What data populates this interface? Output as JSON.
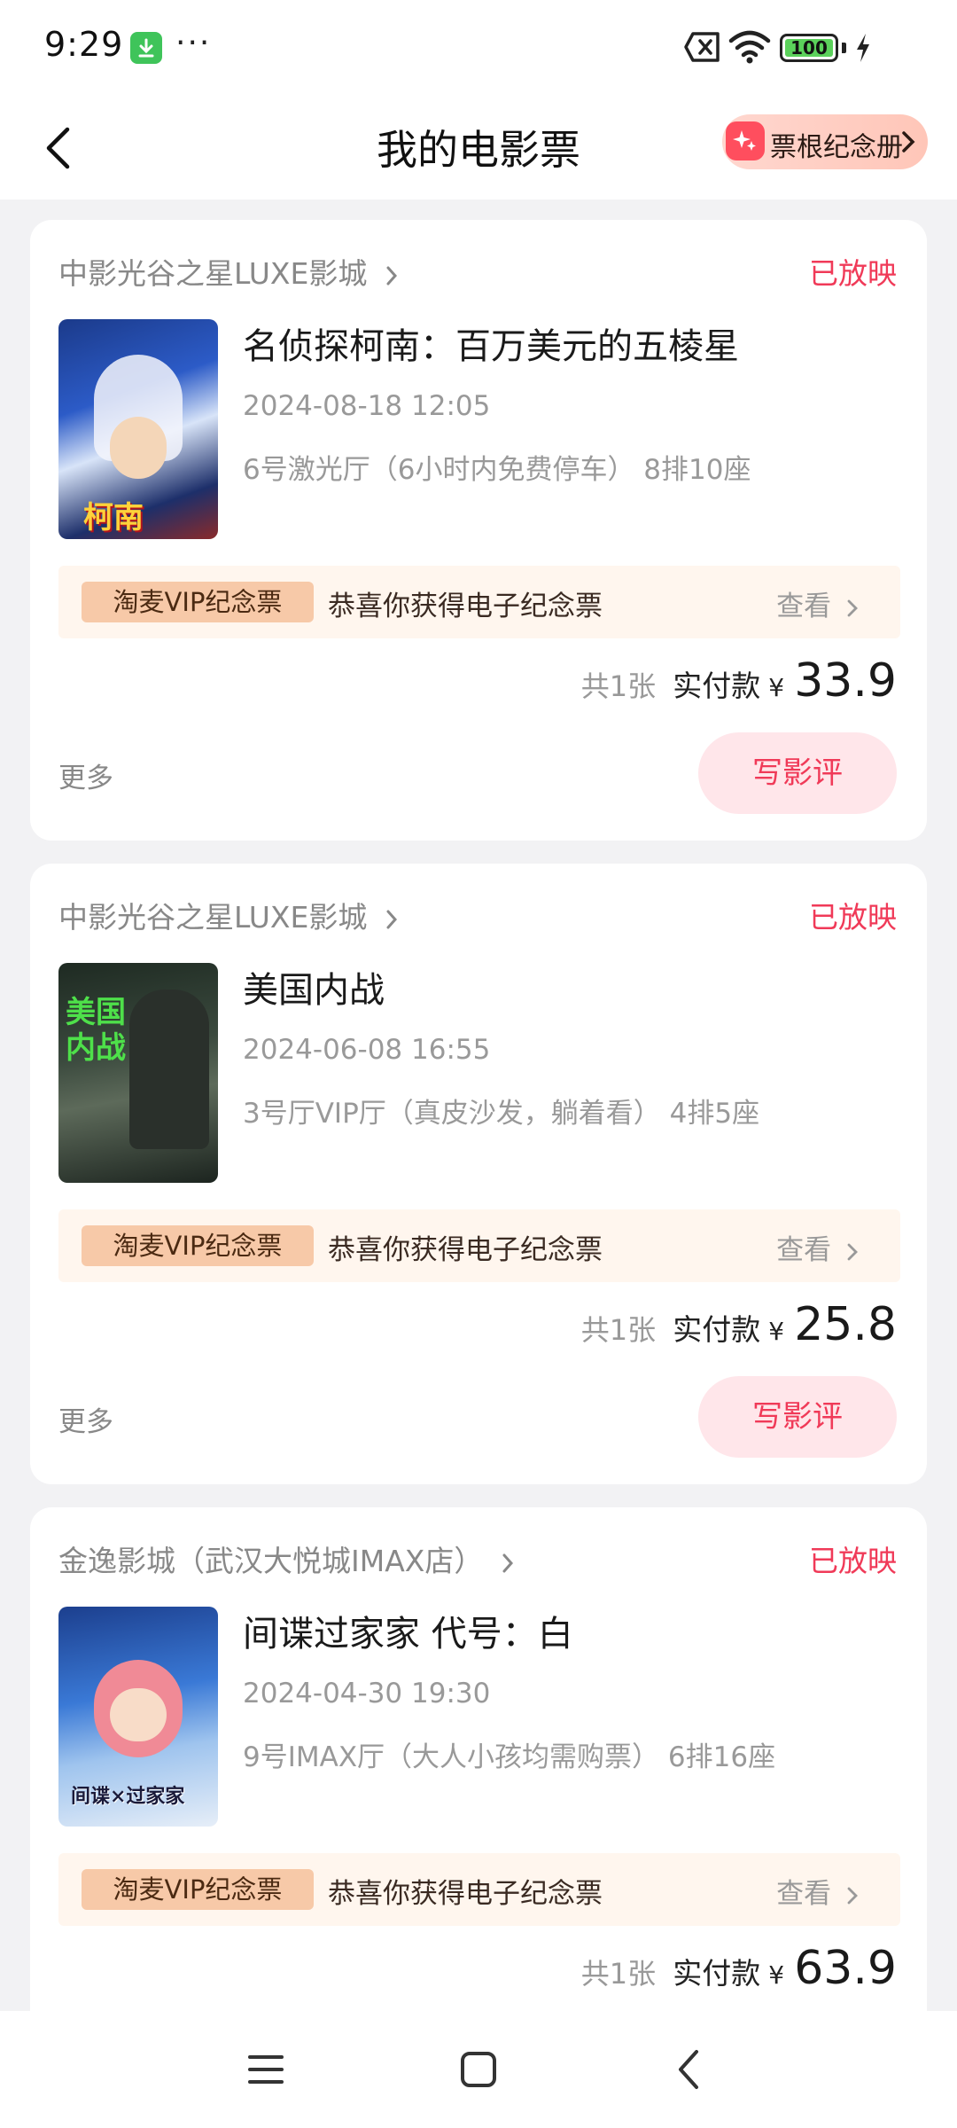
{
  "status_bar": {
    "time": "9:29",
    "dots": "···",
    "battery": "100"
  },
  "header": {
    "title": "我的电影票",
    "stub_button": "票根纪念册"
  },
  "tickets": [
    {
      "cinema": "中影光谷之星LUXE影城",
      "status": "已放映",
      "title": "名侦探柯南：百万美元的五棱星",
      "time": "2024-08-18 12:05",
      "hall": "6号激光厅（6小时内免费停车） 8排10座",
      "vip_tag": "淘麦VIP纪念票",
      "vip_msg": "恭喜你获得电子纪念票",
      "vip_view": "查看",
      "count": "共1张",
      "paid_label": "实付款",
      "currency": "¥",
      "price": "33.9",
      "more": "更多",
      "review": "写影评"
    },
    {
      "cinema": "中影光谷之星LUXE影城",
      "status": "已放映",
      "title": "美国内战",
      "time": "2024-06-08 16:55",
      "hall": "3号厅VIP厅（真皮沙发，躺着看） 4排5座",
      "vip_tag": "淘麦VIP纪念票",
      "vip_msg": "恭喜你获得电子纪念票",
      "vip_view": "查看",
      "count": "共1张",
      "paid_label": "实付款",
      "currency": "¥",
      "price": "25.8",
      "more": "更多",
      "review": "写影评"
    },
    {
      "cinema": "金逸影城（武汉大悦城IMAX店）",
      "status": "已放映",
      "title": "间谍过家家 代号：白",
      "time": "2024-04-30 19:30",
      "hall": "9号IMAX厅（大人小孩均需购票） 6排16座",
      "vip_tag": "淘麦VIP纪念票",
      "vip_msg": "恭喜你获得电子纪念票",
      "vip_view": "查看",
      "count": "共1张",
      "paid_label": "实付款",
      "currency": "¥",
      "price": "63.9"
    }
  ],
  "posters": {
    "p1_title": "柯南",
    "p2_title": "美国内战",
    "p3_title": "间谍×过家家"
  },
  "colors": {
    "accent": "#f03a58",
    "review_bg": "#ffe6ea",
    "vip_bg": "#fff6ee",
    "vip_tag_bg": "#f7c9a8"
  }
}
